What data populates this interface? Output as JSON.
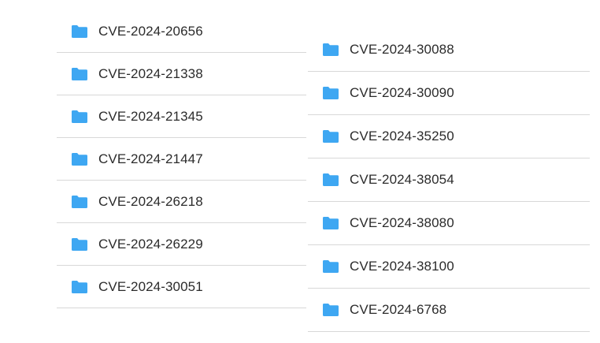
{
  "colors": {
    "folder": "#3ea7f2",
    "divider": "#d8d8d8",
    "text": "#2b2b2b"
  },
  "folders_left": [
    {
      "label": "CVE-2024-20656",
      "icon": "folder-icon"
    },
    {
      "label": "CVE-2024-21338",
      "icon": "folder-icon"
    },
    {
      "label": "CVE-2024-21345",
      "icon": "folder-icon"
    },
    {
      "label": "CVE-2024-21447",
      "icon": "folder-icon"
    },
    {
      "label": "CVE-2024-26218",
      "icon": "folder-icon"
    },
    {
      "label": "CVE-2024-26229",
      "icon": "folder-icon"
    },
    {
      "label": "CVE-2024-30051",
      "icon": "folder-icon"
    }
  ],
  "folders_right": [
    {
      "label": "CVE-2024-30088",
      "icon": "folder-icon"
    },
    {
      "label": "CVE-2024-30090",
      "icon": "folder-icon"
    },
    {
      "label": "CVE-2024-35250",
      "icon": "folder-icon"
    },
    {
      "label": "CVE-2024-38054",
      "icon": "folder-icon"
    },
    {
      "label": "CVE-2024-38080",
      "icon": "folder-icon"
    },
    {
      "label": "CVE-2024-38100",
      "icon": "folder-icon"
    },
    {
      "label": "CVE-2024-6768",
      "icon": "folder-icon"
    }
  ]
}
